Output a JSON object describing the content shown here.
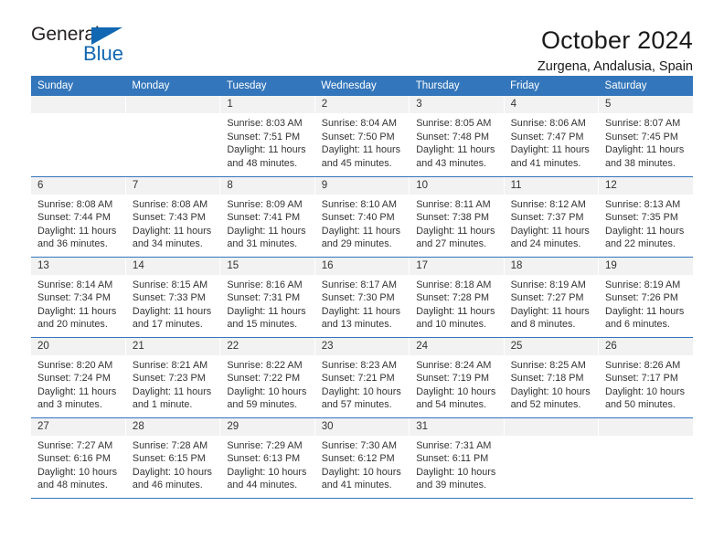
{
  "brand": {
    "name_part1": "General",
    "name_part2": "Blue",
    "triangle_icon": "brand-triangle-icon",
    "accent_color": "#1267b2"
  },
  "header": {
    "title": "October 2024",
    "subtitle": "Zurgena, Andalusia, Spain"
  },
  "theme": {
    "header_bg": "#3376bb",
    "daynum_bg": "#f2f2f2",
    "text": "#333333"
  },
  "weekday_headers": [
    "Sunday",
    "Monday",
    "Tuesday",
    "Wednesday",
    "Thursday",
    "Friday",
    "Saturday"
  ],
  "weeks": [
    [
      {
        "day": "",
        "lines": []
      },
      {
        "day": "",
        "lines": []
      },
      {
        "day": "1",
        "lines": [
          "Sunrise: 8:03 AM",
          "Sunset: 7:51 PM",
          "Daylight: 11 hours",
          "and 48 minutes."
        ]
      },
      {
        "day": "2",
        "lines": [
          "Sunrise: 8:04 AM",
          "Sunset: 7:50 PM",
          "Daylight: 11 hours",
          "and 45 minutes."
        ]
      },
      {
        "day": "3",
        "lines": [
          "Sunrise: 8:05 AM",
          "Sunset: 7:48 PM",
          "Daylight: 11 hours",
          "and 43 minutes."
        ]
      },
      {
        "day": "4",
        "lines": [
          "Sunrise: 8:06 AM",
          "Sunset: 7:47 PM",
          "Daylight: 11 hours",
          "and 41 minutes."
        ]
      },
      {
        "day": "5",
        "lines": [
          "Sunrise: 8:07 AM",
          "Sunset: 7:45 PM",
          "Daylight: 11 hours",
          "and 38 minutes."
        ]
      }
    ],
    [
      {
        "day": "6",
        "lines": [
          "Sunrise: 8:08 AM",
          "Sunset: 7:44 PM",
          "Daylight: 11 hours",
          "and 36 minutes."
        ]
      },
      {
        "day": "7",
        "lines": [
          "Sunrise: 8:08 AM",
          "Sunset: 7:43 PM",
          "Daylight: 11 hours",
          "and 34 minutes."
        ]
      },
      {
        "day": "8",
        "lines": [
          "Sunrise: 8:09 AM",
          "Sunset: 7:41 PM",
          "Daylight: 11 hours",
          "and 31 minutes."
        ]
      },
      {
        "day": "9",
        "lines": [
          "Sunrise: 8:10 AM",
          "Sunset: 7:40 PM",
          "Daylight: 11 hours",
          "and 29 minutes."
        ]
      },
      {
        "day": "10",
        "lines": [
          "Sunrise: 8:11 AM",
          "Sunset: 7:38 PM",
          "Daylight: 11 hours",
          "and 27 minutes."
        ]
      },
      {
        "day": "11",
        "lines": [
          "Sunrise: 8:12 AM",
          "Sunset: 7:37 PM",
          "Daylight: 11 hours",
          "and 24 minutes."
        ]
      },
      {
        "day": "12",
        "lines": [
          "Sunrise: 8:13 AM",
          "Sunset: 7:35 PM",
          "Daylight: 11 hours",
          "and 22 minutes."
        ]
      }
    ],
    [
      {
        "day": "13",
        "lines": [
          "Sunrise: 8:14 AM",
          "Sunset: 7:34 PM",
          "Daylight: 11 hours",
          "and 20 minutes."
        ]
      },
      {
        "day": "14",
        "lines": [
          "Sunrise: 8:15 AM",
          "Sunset: 7:33 PM",
          "Daylight: 11 hours",
          "and 17 minutes."
        ]
      },
      {
        "day": "15",
        "lines": [
          "Sunrise: 8:16 AM",
          "Sunset: 7:31 PM",
          "Daylight: 11 hours",
          "and 15 minutes."
        ]
      },
      {
        "day": "16",
        "lines": [
          "Sunrise: 8:17 AM",
          "Sunset: 7:30 PM",
          "Daylight: 11 hours",
          "and 13 minutes."
        ]
      },
      {
        "day": "17",
        "lines": [
          "Sunrise: 8:18 AM",
          "Sunset: 7:28 PM",
          "Daylight: 11 hours",
          "and 10 minutes."
        ]
      },
      {
        "day": "18",
        "lines": [
          "Sunrise: 8:19 AM",
          "Sunset: 7:27 PM",
          "Daylight: 11 hours",
          "and 8 minutes."
        ]
      },
      {
        "day": "19",
        "lines": [
          "Sunrise: 8:19 AM",
          "Sunset: 7:26 PM",
          "Daylight: 11 hours",
          "and 6 minutes."
        ]
      }
    ],
    [
      {
        "day": "20",
        "lines": [
          "Sunrise: 8:20 AM",
          "Sunset: 7:24 PM",
          "Daylight: 11 hours",
          "and 3 minutes."
        ]
      },
      {
        "day": "21",
        "lines": [
          "Sunrise: 8:21 AM",
          "Sunset: 7:23 PM",
          "Daylight: 11 hours",
          "and 1 minute."
        ]
      },
      {
        "day": "22",
        "lines": [
          "Sunrise: 8:22 AM",
          "Sunset: 7:22 PM",
          "Daylight: 10 hours",
          "and 59 minutes."
        ]
      },
      {
        "day": "23",
        "lines": [
          "Sunrise: 8:23 AM",
          "Sunset: 7:21 PM",
          "Daylight: 10 hours",
          "and 57 minutes."
        ]
      },
      {
        "day": "24",
        "lines": [
          "Sunrise: 8:24 AM",
          "Sunset: 7:19 PM",
          "Daylight: 10 hours",
          "and 54 minutes."
        ]
      },
      {
        "day": "25",
        "lines": [
          "Sunrise: 8:25 AM",
          "Sunset: 7:18 PM",
          "Daylight: 10 hours",
          "and 52 minutes."
        ]
      },
      {
        "day": "26",
        "lines": [
          "Sunrise: 8:26 AM",
          "Sunset: 7:17 PM",
          "Daylight: 10 hours",
          "and 50 minutes."
        ]
      }
    ],
    [
      {
        "day": "27",
        "lines": [
          "Sunrise: 7:27 AM",
          "Sunset: 6:16 PM",
          "Daylight: 10 hours",
          "and 48 minutes."
        ]
      },
      {
        "day": "28",
        "lines": [
          "Sunrise: 7:28 AM",
          "Sunset: 6:15 PM",
          "Daylight: 10 hours",
          "and 46 minutes."
        ]
      },
      {
        "day": "29",
        "lines": [
          "Sunrise: 7:29 AM",
          "Sunset: 6:13 PM",
          "Daylight: 10 hours",
          "and 44 minutes."
        ]
      },
      {
        "day": "30",
        "lines": [
          "Sunrise: 7:30 AM",
          "Sunset: 6:12 PM",
          "Daylight: 10 hours",
          "and 41 minutes."
        ]
      },
      {
        "day": "31",
        "lines": [
          "Sunrise: 7:31 AM",
          "Sunset: 6:11 PM",
          "Daylight: 10 hours",
          "and 39 minutes."
        ]
      },
      {
        "day": "",
        "lines": []
      },
      {
        "day": "",
        "lines": []
      }
    ]
  ]
}
